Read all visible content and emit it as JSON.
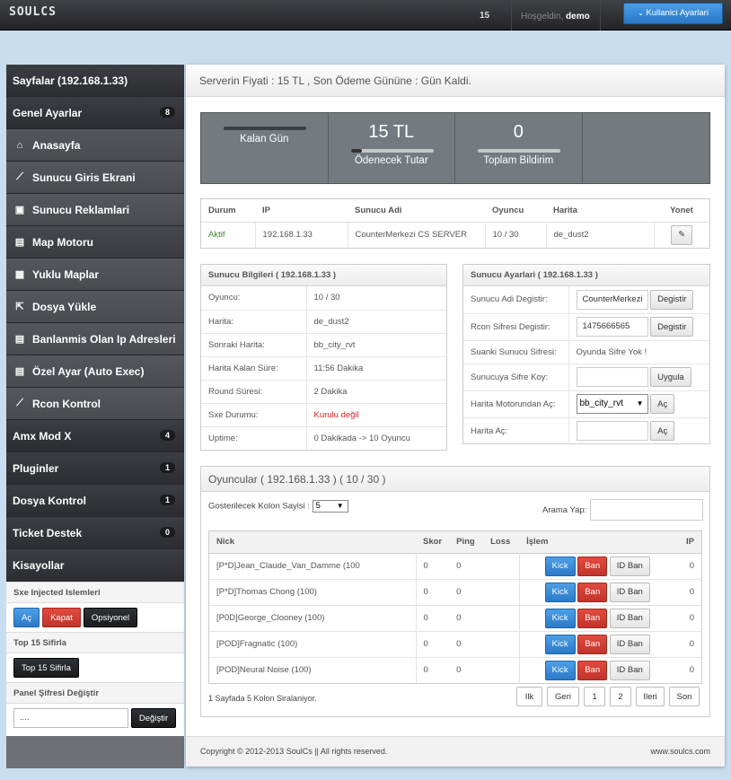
{
  "topbar": {
    "logo": "SOULCS",
    "notification_count": "15",
    "welcome_prefix": "Hoşgeldin,",
    "username": "demo",
    "user_button": "Kullanici Ayarlari"
  },
  "sidebar": {
    "title": "Sayfalar (192.168.1.33)",
    "groups": [
      {
        "label": "Genel Ayarlar",
        "count": "8"
      }
    ],
    "items": [
      {
        "label": "Anasayfa",
        "icon": "home-icon"
      },
      {
        "label": "Sunucu Giris Ekrani",
        "icon": "chart-icon"
      },
      {
        "label": "Sunucu Reklamlari",
        "icon": "image-icon"
      },
      {
        "label": "Map Motoru",
        "icon": "document-icon"
      },
      {
        "label": "Yuklu Maplar",
        "icon": "grid-icon"
      },
      {
        "label": "Dosya Yükle",
        "icon": "upload-icon"
      },
      {
        "label": "Banlanmis Olan Ip Adresleri",
        "icon": "document-icon"
      },
      {
        "label": "Özel Ayar (Auto Exec)",
        "icon": "document-icon"
      },
      {
        "label": "Rcon Kontrol",
        "icon": "chart-icon"
      }
    ],
    "bottom_groups": [
      {
        "label": "Amx Mod X",
        "count": "4"
      },
      {
        "label": "Pluginler",
        "count": "1"
      },
      {
        "label": "Dosya Kontrol",
        "count": "1"
      },
      {
        "label": "Ticket Destek",
        "count": "0"
      }
    ],
    "shortcuts_title": "Kisayollar",
    "sxe_title": "Sxe Injected Islemleri",
    "sxe_buttons": [
      "Aç",
      "Kapat",
      "Opsiyonel"
    ],
    "top15_title": "Top 15 Sifirla",
    "top15_button": "Top 15 Sifirla",
    "password_title": "Panel Şifresi Değiştir",
    "password_value": "....",
    "password_button": "Değiştir"
  },
  "main": {
    "header": "Serverin Fiyati : 15 TL , Son Ödeme Gününe : Gün Kaldi.",
    "stats": [
      {
        "value": "",
        "label": "Kalan Gün"
      },
      {
        "value": "15 TL",
        "label": "Ödenecek Tutar"
      },
      {
        "value": "0",
        "label": "Toplam Bildirim"
      }
    ],
    "server_table": {
      "headers": [
        "Durum",
        "IP",
        "Sunucu Adi",
        "Oyuncu",
        "Harita",
        "Yonet"
      ],
      "row": {
        "status": "Aktif",
        "ip": "192.168.1.33",
        "name": "CounterMerkezi CS SERVER",
        "players": "10 / 30",
        "map": "de_dust2"
      }
    },
    "info": {
      "title": "Sunucu Bilgileri ( 192.168.1.33 )",
      "rows": [
        {
          "k": "Oyuncu:",
          "v": "10 / 30"
        },
        {
          "k": "Harita:",
          "v": "de_dust2"
        },
        {
          "k": "Sonraki Harita:",
          "v": "bb_city_rvt"
        },
        {
          "k": "Harita Kalan Süre:",
          "v": "11:56 Dakika"
        },
        {
          "k": "Round Süresi:",
          "v": "2 Dakika"
        },
        {
          "k": "Sxe Durumu:",
          "v": "Kurulu değil"
        },
        {
          "k": "Uptime:",
          "v": "0 Dakikada -> 10 Oyuncu"
        }
      ]
    },
    "settings": {
      "title": "Sunucu Ayarlari ( 192.168.1.33 )",
      "name_label": "Sunucu Adi Degistir:",
      "name_value": "CounterMerkezi",
      "name_button": "Degistir",
      "rcon_label": "Rcon Sifresi Degistir:",
      "rcon_value": "1475666565",
      "rcon_button": "Degistir",
      "current_pw_label": "Suanki Sunucu Sifresi:",
      "current_pw_value": "Oyunda Sifre Yok !",
      "set_pw_label": "Sunucuya Sifre Koy:",
      "set_pw_button": "Uygula",
      "map_motor_label": "Harita Motorundan Aç:",
      "map_motor_value": "bb_city_rvt",
      "map_motor_button": "Aç",
      "map_open_label": "Harita Aç:",
      "map_open_button": "Aç"
    },
    "players": {
      "title": "Oyuncular ( 192.168.1.33 ) ( 10 / 30 )",
      "columns_label": "Gosterilecek Kolon Sayisi :",
      "columns_value": "5",
      "search_label": "Arama Yap:",
      "headers": [
        "Nick",
        "Skor",
        "Ping",
        "Loss",
        "İşlem",
        "IP"
      ],
      "rows": [
        {
          "nick": "[P*D]Jean_Claude_Van_Damme (100",
          "score": "0",
          "ping": "0",
          "ip": "0"
        },
        {
          "nick": "[P*D]Thomas Chong (100)",
          "score": "0",
          "ping": "0",
          "ip": "0"
        },
        {
          "nick": "[P0D]George_Clooney (100)",
          "score": "0",
          "ping": "0",
          "ip": "0"
        },
        {
          "nick": "[POD]Fragnatic (100)",
          "score": "0",
          "ping": "0",
          "ip": "0"
        },
        {
          "nick": "[POD]Neural Noise (100)",
          "score": "0",
          "ping": "0",
          "ip": "0"
        }
      ],
      "actions": [
        "Kick",
        "Ban",
        "ID Ban"
      ],
      "summary": "1 Sayfada 5 Kolon Siralaniyor.",
      "pager": [
        "Ilk",
        "Geri",
        "1",
        "2",
        "Ileri",
        "Son"
      ]
    },
    "footer_left": "Copyright © 2012-2013 SoulCs || All rights reserved.",
    "footer_right": "www.soulcs.com"
  }
}
